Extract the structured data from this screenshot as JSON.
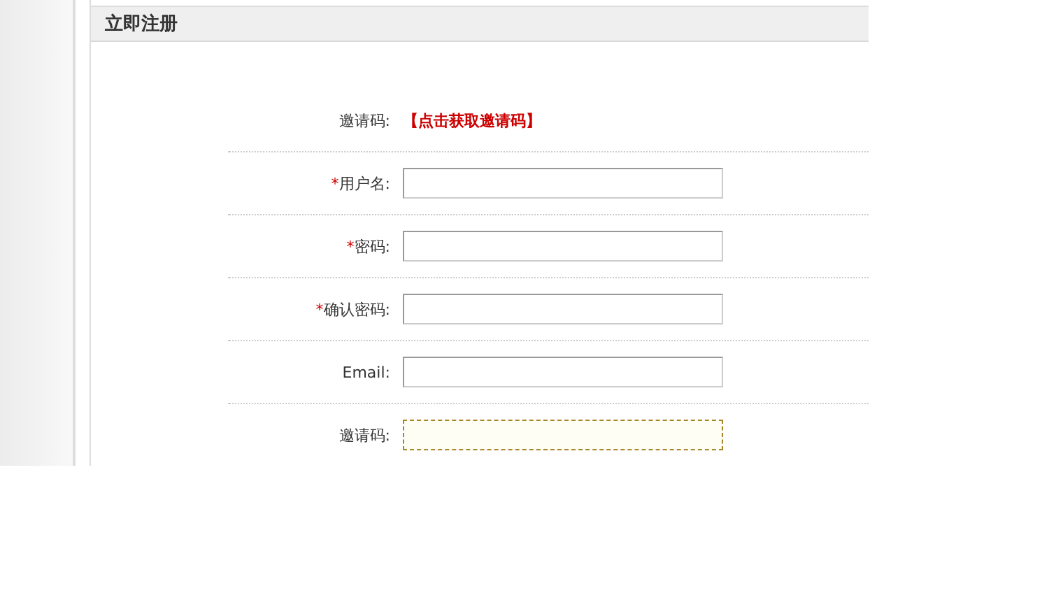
{
  "panel": {
    "title": "立即注册"
  },
  "invite_link": {
    "label": "邀请码:",
    "link": "【点击获取邀请码】"
  },
  "fields": [
    {
      "label": "用户名:",
      "required": true,
      "focused": false
    },
    {
      "label": "密码:",
      "required": true,
      "focused": false
    },
    {
      "label": "确认密码:",
      "required": true,
      "focused": false
    },
    {
      "label": "Email:",
      "required": false,
      "focused": false
    },
    {
      "label": "邀请码:",
      "required": false,
      "focused": true
    }
  ],
  "required_mark": "*"
}
